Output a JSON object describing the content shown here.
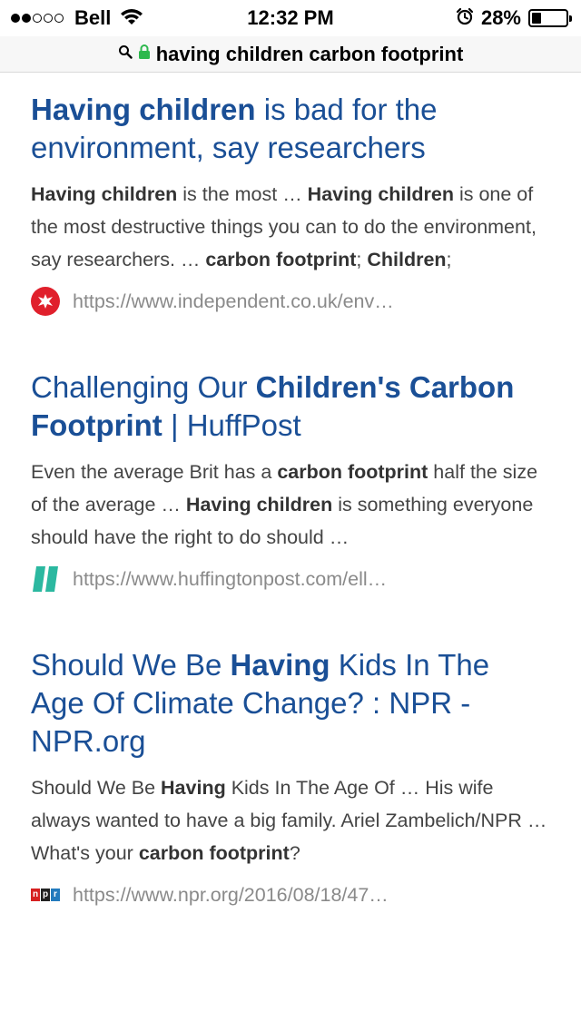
{
  "status_bar": {
    "carrier": "Bell",
    "time": "12:32 PM",
    "battery": "28%",
    "battery_level": 0.28,
    "signal_bars_filled": 2,
    "signal_bars_total": 5
  },
  "address_bar": {
    "query": "having children carbon footprint"
  },
  "results": [
    {
      "title": [
        {
          "text": "Having children",
          "bold": true
        },
        {
          "text": " is bad for the environment, say researchers",
          "bold": false
        }
      ],
      "snippet": [
        {
          "text": "Having children",
          "bold": true
        },
        {
          "text": " is the most … ",
          "bold": false
        },
        {
          "text": "Having children",
          "bold": true
        },
        {
          "text": " is one of the most destructive things you can to do the environment, say researchers. … ",
          "bold": false
        },
        {
          "text": "carbon footprint",
          "bold": true
        },
        {
          "text": "; ",
          "bold": false
        },
        {
          "text": "Children",
          "bold": true
        },
        {
          "text": ";",
          "bold": false
        }
      ],
      "url": "https://www.independent.co.uk/env…",
      "favicon": "independent-eagle-icon",
      "favicon_color": "#e0202c"
    },
    {
      "title": [
        {
          "text": "Challenging Our ",
          "bold": false
        },
        {
          "text": "Children's Carbon Footprint",
          "bold": true
        },
        {
          "text": " | HuffPost",
          "bold": false
        }
      ],
      "snippet": [
        {
          "text": "Even the average Brit has a ",
          "bold": false
        },
        {
          "text": "carbon footprint",
          "bold": true
        },
        {
          "text": " half the size of the average … ",
          "bold": false
        },
        {
          "text": "Having children",
          "bold": true
        },
        {
          "text": " is something everyone should have the right to do should …",
          "bold": false
        }
      ],
      "url": "https://www.huffingtonpost.com/ell…",
      "favicon": "huffpost-icon",
      "favicon_color": "#2bb8a0"
    },
    {
      "title": [
        {
          "text": "Should We Be ",
          "bold": false
        },
        {
          "text": "Having",
          "bold": true
        },
        {
          "text": " Kids In The Age Of Climate Change? : NPR - NPR.org",
          "bold": false
        }
      ],
      "snippet": [
        {
          "text": "Should We Be ",
          "bold": false
        },
        {
          "text": "Having",
          "bold": true
        },
        {
          "text": " Kids In The Age Of … His wife always wanted to have a big family. Ariel Zambelich/NPR … What's your ",
          "bold": false
        },
        {
          "text": "carbon footprint",
          "bold": true
        },
        {
          "text": "?",
          "bold": false
        }
      ],
      "url": "https://www.npr.org/2016/08/18/47…",
      "favicon": "npr-logo-icon",
      "favicon_letters": [
        "n",
        "p",
        "r"
      ],
      "favicon_colors": [
        "#d62021",
        "#222222",
        "#237bbd"
      ]
    }
  ],
  "colors": {
    "link": "#1a4f96",
    "snippet": "#444444",
    "url": "#8a8a8a",
    "lock": "#2db84d"
  }
}
